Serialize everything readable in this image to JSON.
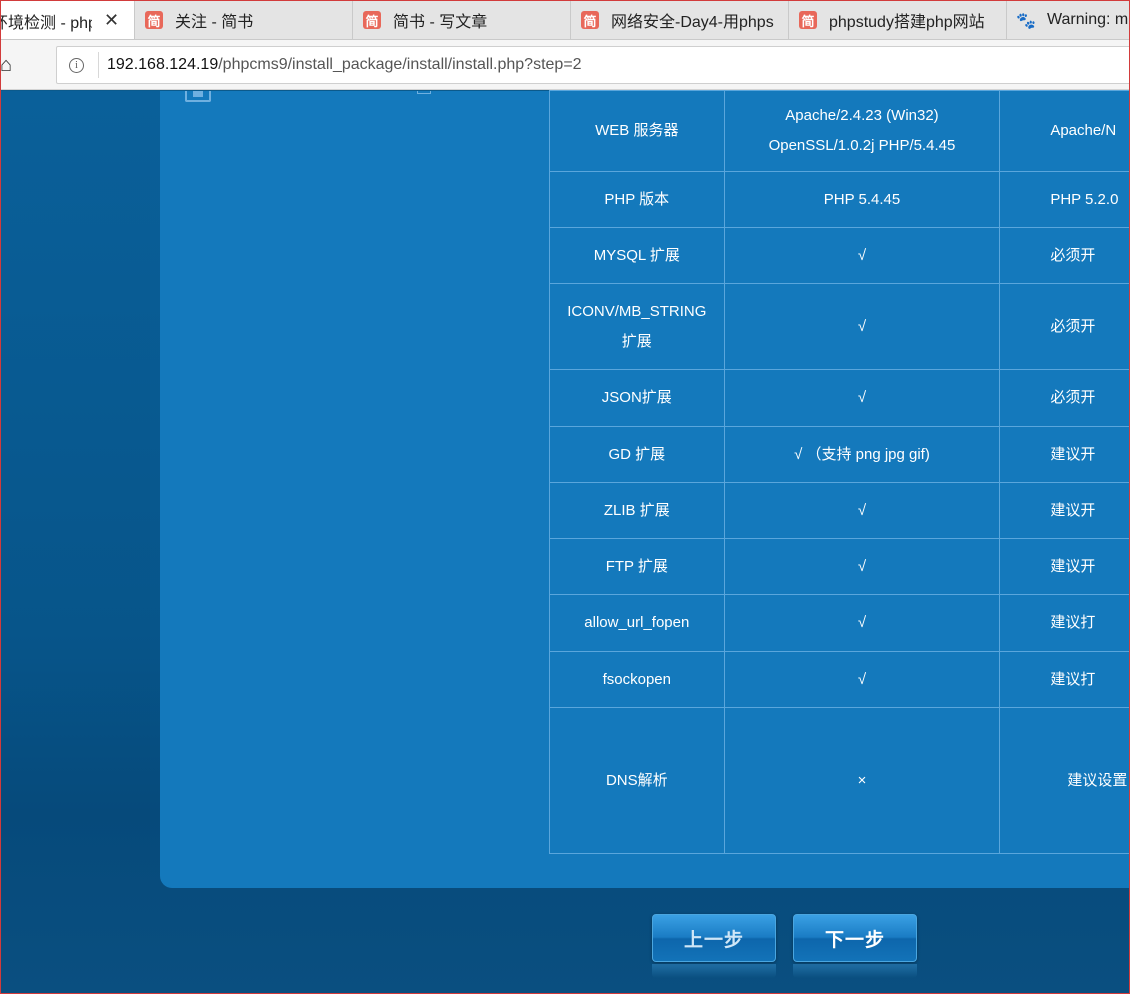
{
  "browser": {
    "tabs": [
      {
        "label": "环境检测 - php",
        "icon": "none",
        "active": true,
        "closable": true
      },
      {
        "label": "关注 - 简书",
        "icon": "jianshu-icon",
        "active": false
      },
      {
        "label": "简书 - 写文章",
        "icon": "jianshu-icon",
        "active": false
      },
      {
        "label": "网络安全-Day4-用phps",
        "icon": "jianshu-icon",
        "active": false
      },
      {
        "label": "phpstudy搭建php网站",
        "icon": "jianshu-icon",
        "active": false
      },
      {
        "label": "Warning: m",
        "icon": "baidu-paw-icon",
        "active": false
      }
    ],
    "tab_favicon_glyph": "简",
    "url_host": "192.168.124.19",
    "url_path": "/phpcms9/install_package/install/install.php?step=2"
  },
  "env_check": {
    "rows": [
      {
        "item": "WEB 服务器",
        "current_lines": [
          "Apache/2.4.23 (Win32)",
          "OpenSSL/1.0.2j PHP/5.4.45"
        ],
        "requirement": "Apache/N"
      },
      {
        "item": "PHP 版本",
        "current_lines": [
          "PHP 5.4.45"
        ],
        "requirement": "PHP 5.2.0"
      },
      {
        "item": "MYSQL 扩展",
        "current_lines": [
          "√"
        ],
        "requirement": "必须开"
      },
      {
        "item": "ICONV/MB_STRING 扩展",
        "current_lines": [
          "√"
        ],
        "requirement": "必须开"
      },
      {
        "item": "JSON扩展",
        "current_lines": [
          "√"
        ],
        "requirement": "必须开"
      },
      {
        "item": "GD 扩展",
        "current_lines": [
          "√ （支持 png jpg gif)"
        ],
        "requirement": "建议开"
      },
      {
        "item": "ZLIB 扩展",
        "current_lines": [
          "√"
        ],
        "requirement": "建议开"
      },
      {
        "item": "FTP 扩展",
        "current_lines": [
          "√"
        ],
        "requirement": "建议开"
      },
      {
        "item": "allow_url_fopen",
        "current_lines": [
          "√"
        ],
        "requirement": "建议打"
      },
      {
        "item": "fsockopen",
        "current_lines": [
          "√"
        ],
        "requirement": "建议打"
      },
      {
        "item": "DNS解析",
        "current_lines": [
          "×"
        ],
        "requirement": "建议设置"
      }
    ]
  },
  "buttons": {
    "prev_label": "上一步",
    "next_label": "下一步"
  },
  "colors": {
    "panel": "#1479bc",
    "page_background": "#07558a",
    "table_border": "#5aa6dc"
  }
}
